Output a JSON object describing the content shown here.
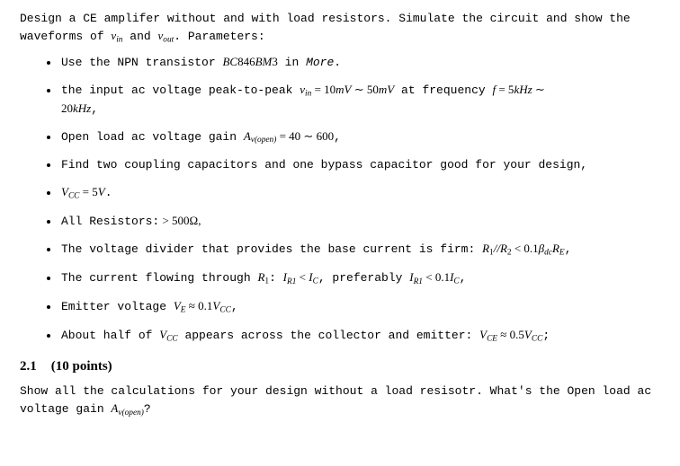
{
  "intro": {
    "text1": "Design a CE amplifer without and with load resistors.  Simulate the circuit and show the waveforms of ",
    "vin_var": "v",
    "vin_sub": "in",
    "and_word": " and ",
    "vout_var": "v",
    "vout_sub": "out",
    "text2": ".  Parameters:"
  },
  "bullets": [
    {
      "pre": "Use the NPN transistor ",
      "model_ital": "BC",
      "model_rest": "846",
      "model_ital2": "BM",
      "model_rest2": "3",
      "mid": " in ",
      "place": "More",
      "post": "."
    },
    {
      "pre": "the input ac voltage peak-to-peak ",
      "sym_v": "v",
      "sym_vin_sub": "in",
      "eq1": " = 10",
      "unit1": "mV",
      "tilde1": " ∼ 50",
      "unit2": "mV",
      "mid": " at frequency ",
      "sym_f": "f",
      "eq2": " = 5",
      "unit3": "kHz",
      "tilde2": " ∼ ",
      "line2_val": "20",
      "line2_unit": "kHz",
      "line2_post": ","
    },
    {
      "pre": "Open load ac voltage gain ",
      "sym_A": "A",
      "sub_full": "v(open)",
      "eq": " = 40 ∼ 600",
      "post": ","
    },
    {
      "text": "Find two coupling capacitors and one bypass capacitor good for your design,"
    },
    {
      "sym_V": "V",
      "sub_cc": "CC",
      "eq": " = 5",
      "unit": "V",
      "post": "."
    },
    {
      "pre": "All Resistors:",
      "spaces": "   > 500Ω,",
      "post": ""
    },
    {
      "pre": "The voltage divider that provides the base current is firm:   ",
      "r1": "R",
      "r1s": "1",
      "slash": "//",
      "r2": "R",
      "r2s": "2",
      "lt": " < 0.1",
      "beta": "β",
      "beta_sub": "dc",
      "re": "R",
      "re_s": "E",
      "post": ","
    },
    {
      "pre": "The current flowing through ",
      "r1": "R",
      "r1s": "1",
      "mid": ":   ",
      "ir1": "I",
      "ir1s": "R1",
      "lt": " < ",
      "ic": "I",
      "ics": "C",
      "mid2": ", preferably ",
      "ir1b": "I",
      "ir1bs": "R1",
      "lt2": " < 0.1",
      "ic2": "I",
      "ic2s": "C",
      "post": ","
    },
    {
      "pre": "Emitter voltage ",
      "ve": "V",
      "ves": "E",
      "approx": " ≈ 0.1",
      "vcc": "V",
      "vccs": "CC",
      "post": ","
    },
    {
      "pre": "About half of ",
      "vcc": "V",
      "vccs": "CC",
      "mid": " appears across the collector and emitter:   ",
      "vce": "V",
      "vces": "CE",
      "approx": " ≈ 0.5",
      "vcc2": "V",
      "vcc2s": "CC",
      "post": ";"
    }
  ],
  "section": {
    "num": "2.1",
    "title": "(10 points)"
  },
  "question": {
    "t1": "Show all the calculations for your design without a load resisotr.  What's the Open load ac voltage gain ",
    "sym_A": "A",
    "sub_full": "v(open)",
    "t2": "?"
  }
}
